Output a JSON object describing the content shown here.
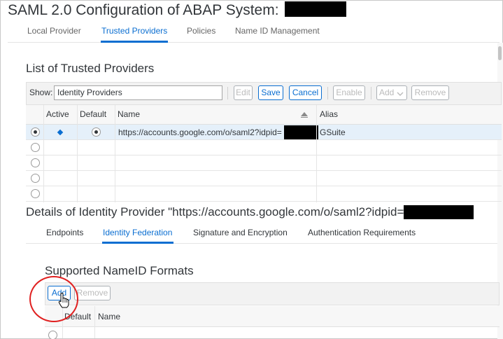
{
  "page": {
    "title": "SAML 2.0 Configuration of ABAP System:"
  },
  "tabs": [
    {
      "label": "Local Provider"
    },
    {
      "label": "Trusted Providers"
    },
    {
      "label": "Policies"
    },
    {
      "label": "Name ID Management"
    }
  ],
  "list": {
    "title": "List of Trusted Providers",
    "show_label": "Show:",
    "show_value": "Identity Providers",
    "buttons": {
      "edit": "Edit",
      "save": "Save",
      "cancel": "Cancel",
      "enable": "Enable",
      "add": "Add",
      "remove": "Remove"
    },
    "columns": {
      "active": "Active",
      "default": "Default",
      "name": "Name",
      "alias": "Alias"
    },
    "rows": [
      {
        "name": "https://accounts.google.com/o/saml2?idpid=",
        "alias": "GSuite"
      }
    ]
  },
  "details": {
    "title": "Details of Identity Provider \"https://accounts.google.com/o/saml2?idpid=",
    "tabs": [
      {
        "label": "Endpoints"
      },
      {
        "label": "Identity Federation"
      },
      {
        "label": "Signature and Encryption"
      },
      {
        "label": "Authentication Requirements"
      }
    ]
  },
  "nameid": {
    "title": "Supported NameID Formats",
    "buttons": {
      "add": "Add",
      "remove": "Remove"
    },
    "columns": {
      "default": "Default",
      "name": "Name"
    }
  },
  "icons": {
    "sort": "sort-ascending-icon",
    "dropdown": "chevron-down-icon",
    "cursor": "hand-cursor-icon"
  },
  "colors": {
    "accent": "#0a6ed1",
    "annotation": "#e02020"
  }
}
